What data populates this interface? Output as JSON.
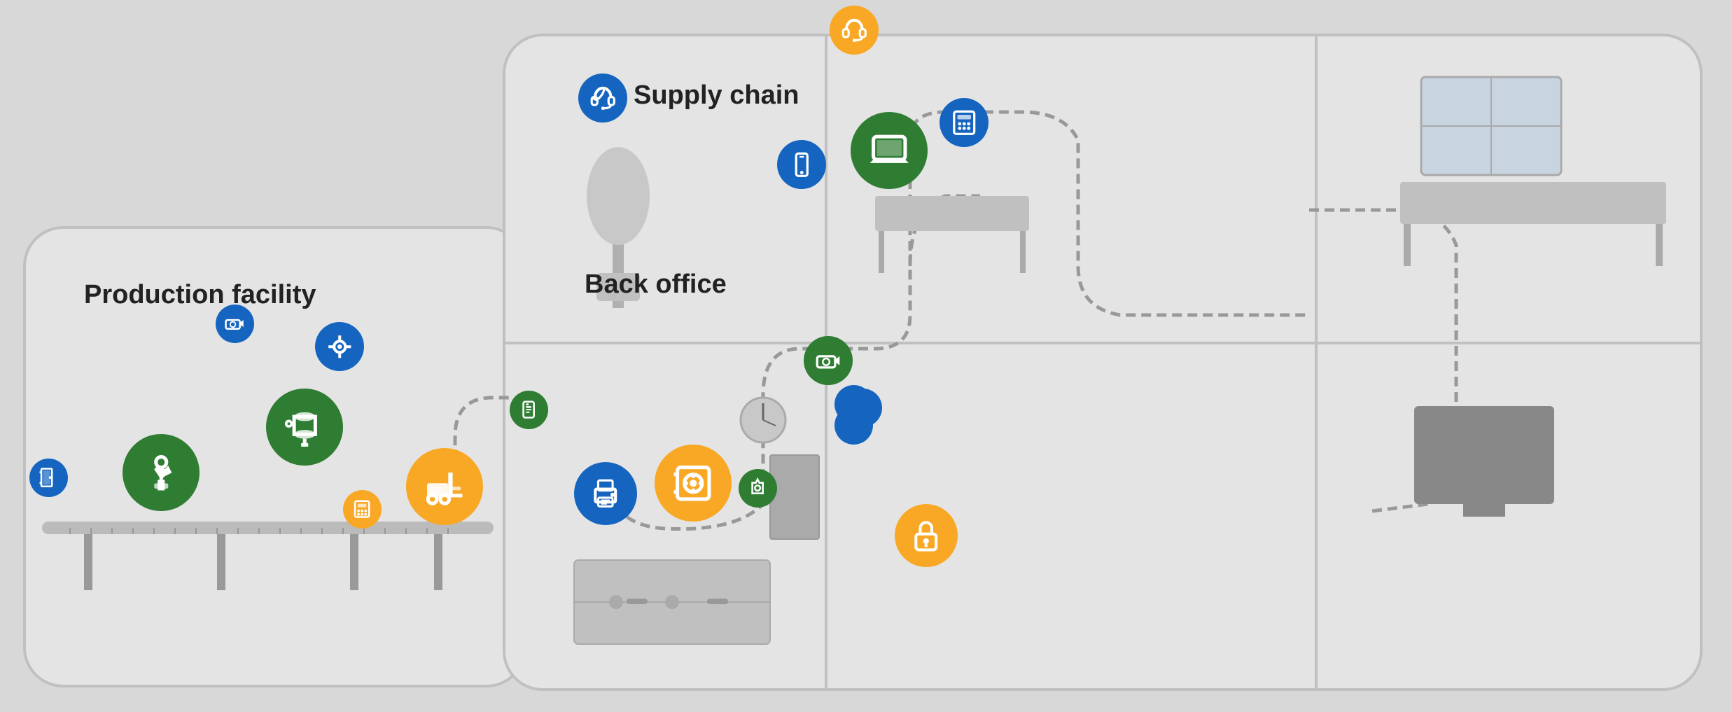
{
  "labels": {
    "production_facility": "Production facility",
    "back_office": "Back office",
    "supply_chain": "Supply chain"
  },
  "icons": {
    "robot_arm": "robot-arm-icon",
    "storage_tank": "storage-tank-icon",
    "forklift": "forklift-icon",
    "keypad": "keypad-icon",
    "camera_prod": "camera-icon",
    "pipe_valve": "pipe-valve-icon",
    "door_sensor": "door-sensor-icon",
    "printer": "printer-icon",
    "safe": "safe-icon",
    "camera_office": "camera-icon",
    "small_camera": "small-camera-icon",
    "card_reader": "card-reader-icon",
    "thermostat": "thermostat-icon",
    "lock_yellow": "lock-icon",
    "laptop": "laptop-icon",
    "phone": "phone-icon",
    "headset_yellow": "headset-icon",
    "headset_blue": "headset-blue-icon",
    "keypad_office": "keypad-office-icon",
    "camera_supply": "camera-supply-icon"
  },
  "colors": {
    "green": "#2e7d32",
    "blue": "#1565c0",
    "yellow": "#f9a825",
    "background": "#d8d8d8",
    "building": "#e8e8e8",
    "path": "#999999"
  }
}
